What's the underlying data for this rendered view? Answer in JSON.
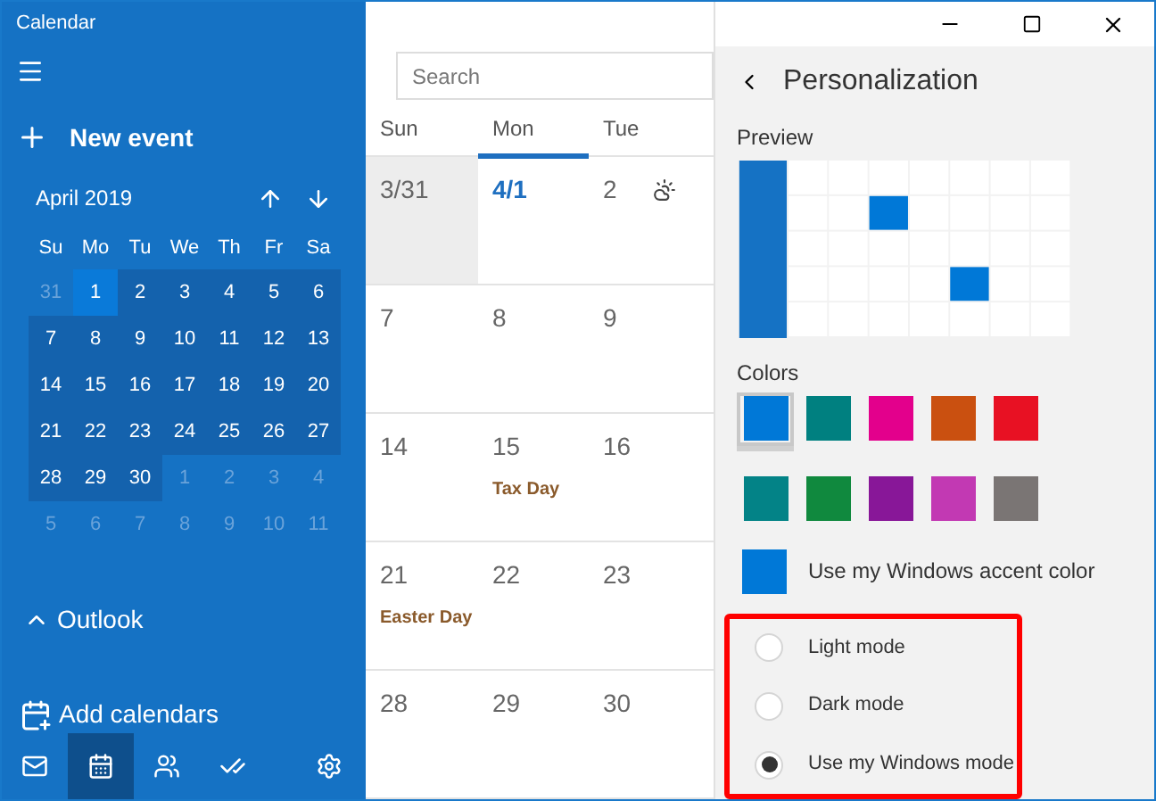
{
  "window": {
    "title": "Calendar"
  },
  "sidebar": {
    "new_event": "New event",
    "month_label": "April 2019",
    "weekdays": [
      "Su",
      "Mo",
      "Tu",
      "We",
      "Th",
      "Fr",
      "Sa"
    ],
    "days": [
      {
        "label": "31",
        "in_month": false,
        "selected": false
      },
      {
        "label": "1",
        "in_month": true,
        "selected": true
      },
      {
        "label": "2",
        "in_month": true,
        "selected": false
      },
      {
        "label": "3",
        "in_month": true,
        "selected": false
      },
      {
        "label": "4",
        "in_month": true,
        "selected": false
      },
      {
        "label": "5",
        "in_month": true,
        "selected": false
      },
      {
        "label": "6",
        "in_month": true,
        "selected": false
      },
      {
        "label": "7",
        "in_month": true,
        "selected": false
      },
      {
        "label": "8",
        "in_month": true,
        "selected": false
      },
      {
        "label": "9",
        "in_month": true,
        "selected": false
      },
      {
        "label": "10",
        "in_month": true,
        "selected": false
      },
      {
        "label": "11",
        "in_month": true,
        "selected": false
      },
      {
        "label": "12",
        "in_month": true,
        "selected": false
      },
      {
        "label": "13",
        "in_month": true,
        "selected": false
      },
      {
        "label": "14",
        "in_month": true,
        "selected": false
      },
      {
        "label": "15",
        "in_month": true,
        "selected": false
      },
      {
        "label": "16",
        "in_month": true,
        "selected": false
      },
      {
        "label": "17",
        "in_month": true,
        "selected": false
      },
      {
        "label": "18",
        "in_month": true,
        "selected": false
      },
      {
        "label": "19",
        "in_month": true,
        "selected": false
      },
      {
        "label": "20",
        "in_month": true,
        "selected": false
      },
      {
        "label": "21",
        "in_month": true,
        "selected": false
      },
      {
        "label": "22",
        "in_month": true,
        "selected": false
      },
      {
        "label": "23",
        "in_month": true,
        "selected": false
      },
      {
        "label": "24",
        "in_month": true,
        "selected": false
      },
      {
        "label": "25",
        "in_month": true,
        "selected": false
      },
      {
        "label": "26",
        "in_month": true,
        "selected": false
      },
      {
        "label": "27",
        "in_month": true,
        "selected": false
      },
      {
        "label": "28",
        "in_month": true,
        "selected": false
      },
      {
        "label": "29",
        "in_month": true,
        "selected": false
      },
      {
        "label": "30",
        "in_month": true,
        "selected": false
      },
      {
        "label": "1",
        "in_month": false,
        "selected": false
      },
      {
        "label": "2",
        "in_month": false,
        "selected": false
      },
      {
        "label": "3",
        "in_month": false,
        "selected": false
      },
      {
        "label": "4",
        "in_month": false,
        "selected": false
      },
      {
        "label": "5",
        "in_month": false,
        "selected": false
      },
      {
        "label": "6",
        "in_month": false,
        "selected": false
      },
      {
        "label": "7",
        "in_month": false,
        "selected": false
      },
      {
        "label": "8",
        "in_month": false,
        "selected": false
      },
      {
        "label": "9",
        "in_month": false,
        "selected": false
      },
      {
        "label": "10",
        "in_month": false,
        "selected": false
      },
      {
        "label": "11",
        "in_month": false,
        "selected": false
      }
    ],
    "group": {
      "label": "Outlook",
      "expanded": true
    },
    "add_calendars": "Add calendars",
    "nav": [
      {
        "kind": "mail",
        "selected": false
      },
      {
        "kind": "calendar",
        "selected": true
      },
      {
        "kind": "people",
        "selected": false
      },
      {
        "kind": "todo",
        "selected": false
      },
      {
        "kind": "settings",
        "selected": false
      }
    ]
  },
  "search": {
    "placeholder": "Search"
  },
  "month_view": {
    "columns": [
      {
        "label": "Sun",
        "selected": false
      },
      {
        "label": "Mon",
        "selected": true
      },
      {
        "label": "Tue",
        "selected": false
      }
    ],
    "weeks": [
      [
        {
          "date": "3/31",
          "in_month": false,
          "today": false
        },
        {
          "date": "4/1",
          "in_month": true,
          "today": true
        },
        {
          "date": "2",
          "in_month": true,
          "today": false,
          "weather": true
        }
      ],
      [
        {
          "date": "7",
          "in_month": true,
          "today": false
        },
        {
          "date": "8",
          "in_month": true,
          "today": false
        },
        {
          "date": "9",
          "in_month": true,
          "today": false
        }
      ],
      [
        {
          "date": "14",
          "in_month": true,
          "today": false
        },
        {
          "date": "15",
          "in_month": true,
          "today": false,
          "event": "Tax Day"
        },
        {
          "date": "16",
          "in_month": true,
          "today": false
        }
      ],
      [
        {
          "date": "21",
          "in_month": true,
          "today": false,
          "event": "Easter Day"
        },
        {
          "date": "22",
          "in_month": true,
          "today": false
        },
        {
          "date": "23",
          "in_month": true,
          "today": false
        }
      ],
      [
        {
          "date": "28",
          "in_month": true,
          "today": false
        },
        {
          "date": "29",
          "in_month": true,
          "today": false
        },
        {
          "date": "30",
          "in_month": true,
          "today": false
        }
      ]
    ]
  },
  "panel": {
    "title": "Personalization",
    "preview_label": "Preview",
    "colors_label": "Colors",
    "colors": [
      {
        "color": "#0078d7",
        "selected": true
      },
      {
        "color": "#008080",
        "selected": false
      },
      {
        "color": "#e3008c",
        "selected": false
      },
      {
        "color": "#ca5010",
        "selected": false
      },
      {
        "color": "#e81123",
        "selected": false
      },
      {
        "color": "#038387",
        "selected": false
      },
      {
        "color": "#10893e",
        "selected": false
      },
      {
        "color": "#881798",
        "selected": false
      },
      {
        "color": "#c239b3",
        "selected": false
      },
      {
        "color": "#7a7574",
        "selected": false
      }
    ],
    "accent": {
      "label": "Use my Windows accent color",
      "color": "#0078d7"
    },
    "modes": [
      {
        "label": "Light mode",
        "selected": false
      },
      {
        "label": "Dark mode",
        "selected": false
      },
      {
        "label": "Use my Windows mode",
        "selected": true
      }
    ]
  }
}
